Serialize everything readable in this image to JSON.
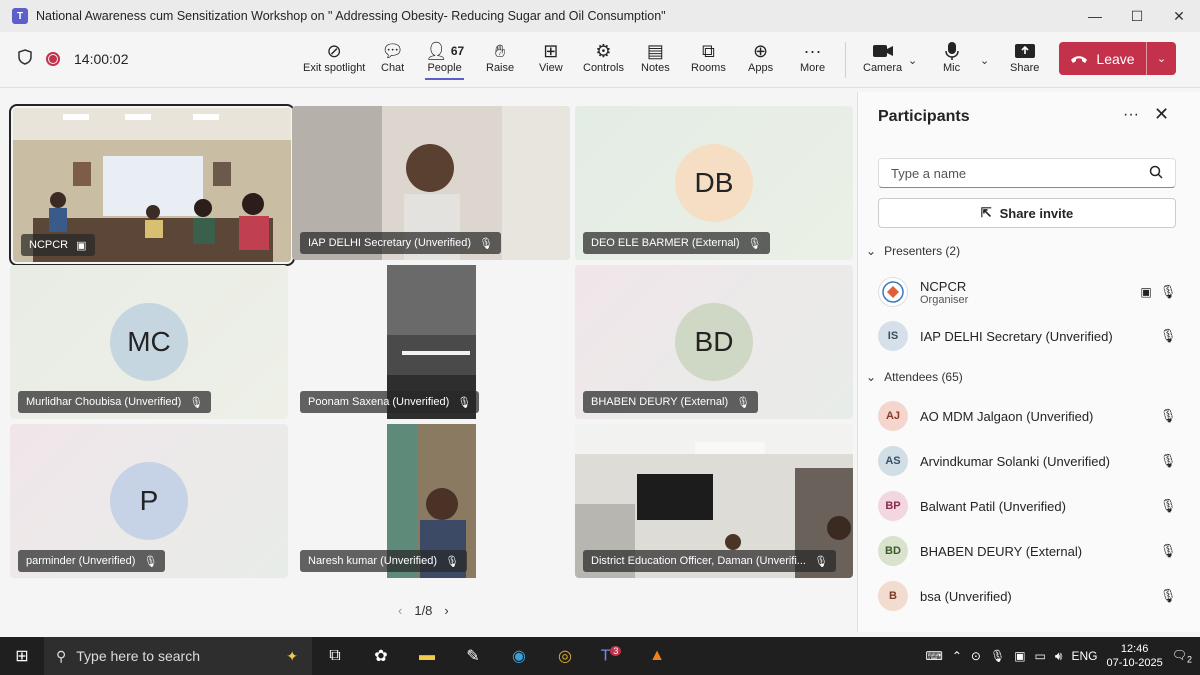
{
  "window": {
    "title": "National Awareness cum Sensitization Workshop on \" Addressing Obesity- Reducing Sugar and Oil Consumption\"",
    "minimize": "—",
    "maximize": "☐",
    "close": "✕"
  },
  "toolbar": {
    "timer": "14:00:02",
    "exit_spotlight": "Exit spotlight",
    "chat": "Chat",
    "people": "People",
    "people_count": "67",
    "raise": "Raise",
    "view": "View",
    "controls": "Controls",
    "notes": "Notes",
    "rooms": "Rooms",
    "apps": "Apps",
    "more": "More",
    "camera": "Camera",
    "mic": "Mic",
    "share": "Share",
    "leave": "Leave"
  },
  "tiles": [
    {
      "name": "NCPCR"
    },
    {
      "name": "IAP DELHI Secretary (Unverified)"
    },
    {
      "name": "DEO ELE BARMER (External)",
      "initials": "DB"
    },
    {
      "name": "Murlidhar Choubisa (Unverified)",
      "initials": "MC"
    },
    {
      "name": "Poonam Saxena (Unverified)"
    },
    {
      "name": "BHABEN DEURY (External)",
      "initials": "BD"
    },
    {
      "name": "parminder (Unverified)",
      "initials": "P"
    },
    {
      "name": "Naresh kumar (Unverified)"
    },
    {
      "name": "District Education Officer, Daman (Unverifi..."
    }
  ],
  "pager": {
    "label": "1/8"
  },
  "panel": {
    "title": "Participants",
    "search_placeholder": "Type a name",
    "share_invite": "Share invite",
    "presenters_label": "Presenters (2)",
    "attendees_label": "Attendees (65)",
    "presenters": [
      {
        "name": "NCPCR",
        "role": "Organiser"
      },
      {
        "initials": "IS",
        "name": "IAP DELHI Secretary (Unverified)"
      }
    ],
    "attendees": [
      {
        "initials": "AJ",
        "name": "AO MDM Jalgaon (Unverified)"
      },
      {
        "initials": "AS",
        "name": "Arvindkumar Solanki (Unverified)"
      },
      {
        "initials": "BP",
        "name": "Balwant Patil (Unverified)"
      },
      {
        "initials": "BD",
        "name": "BHABEN DEURY (External)"
      },
      {
        "initials": "B",
        "name": "bsa (Unverified)"
      }
    ]
  },
  "taskbar": {
    "search_placeholder": "Type here to search",
    "teams_badge": "3",
    "lang": "ENG",
    "time": "12:46",
    "date": "07-10-2025",
    "notif_count": "2"
  },
  "colors": {
    "accent": "#5b5fc7",
    "leave": "#c4314b"
  }
}
